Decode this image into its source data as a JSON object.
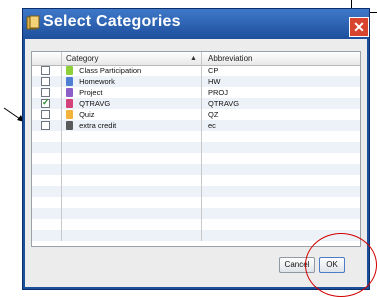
{
  "dialog": {
    "title": "Select Categories",
    "close_glyph": "✕"
  },
  "table": {
    "columns": [
      "",
      "Category",
      "Abbreviation"
    ],
    "sort_icon": "▲",
    "rows": [
      {
        "category": "Class Participation",
        "abbreviation": "CP",
        "checked": false,
        "icon_color": "#8fcf3a"
      },
      {
        "category": "Homework",
        "abbreviation": "HW",
        "checked": false,
        "icon_color": "#4f7fd3"
      },
      {
        "category": "Project",
        "abbreviation": "PROJ",
        "checked": false,
        "icon_color": "#8b5fc7"
      },
      {
        "category": "QTRAVG",
        "abbreviation": "QTRAVG",
        "checked": true,
        "icon_color": "#d4427a"
      },
      {
        "category": "Quiz",
        "abbreviation": "QZ",
        "checked": false,
        "icon_color": "#f3b23a"
      },
      {
        "category": "extra credit",
        "abbreviation": "ec",
        "checked": false,
        "icon_color": "#5a5a5a"
      }
    ]
  },
  "buttons": {
    "cancel": "Cancel",
    "ok": "OK"
  },
  "colors": {
    "titlebar": "#2a5eb0",
    "annotation_red": "#d10000",
    "check_green": "#2a8a2a"
  },
  "icons": {
    "title": "categories-icon",
    "close": "close-icon",
    "sort": "sort-ascending-icon",
    "annotation_arrow": "pointer-arrow-icon"
  }
}
